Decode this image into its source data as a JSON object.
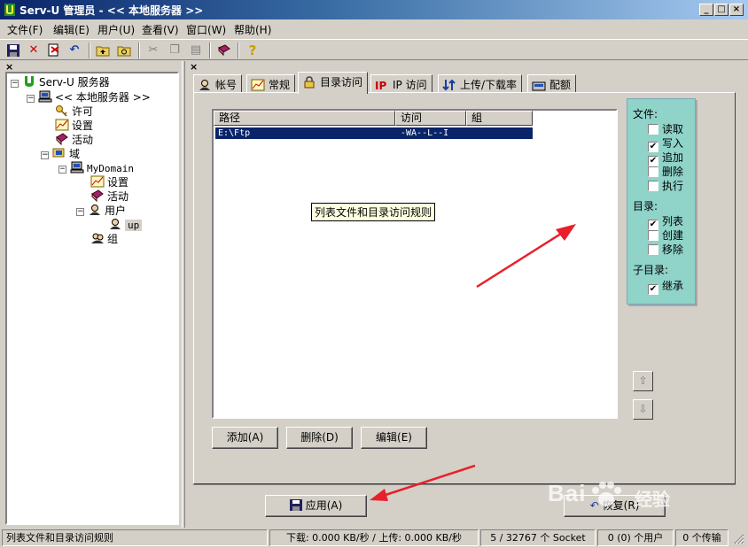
{
  "window": {
    "title": "Serv-U 管理员 - << 本地服务器 >>",
    "min_glyph": "_",
    "max_glyph": "□",
    "close_glyph": "×"
  },
  "menu": [
    "文件(F)",
    "编辑(E)",
    "用户(U)",
    "查看(V)",
    "窗口(W)",
    "帮助(H)"
  ],
  "toolbar": {
    "icons": [
      "save-icon",
      "delete-icon",
      "cut-user-icon",
      "undo-icon",
      "folder-up-icon",
      "folder-refresh-icon",
      "cut-icon",
      "copy-icon",
      "paste-icon",
      "book-icon",
      "help-icon"
    ]
  },
  "tree": {
    "close_glyph": "×",
    "expand_glyph": "−",
    "nodes": [
      {
        "label": "Serv-U 服务器"
      },
      {
        "label": "<< 本地服务器 >>"
      },
      {
        "label": "许可"
      },
      {
        "label": "设置"
      },
      {
        "label": "活动"
      },
      {
        "label": "域"
      },
      {
        "label": "MyDomain"
      },
      {
        "label": "设置"
      },
      {
        "label": "活动"
      },
      {
        "label": "用户"
      },
      {
        "label": "up"
      },
      {
        "label": "组"
      }
    ]
  },
  "tabs": [
    {
      "label": "帐号"
    },
    {
      "label": "常规"
    },
    {
      "label": "目录访问"
    },
    {
      "label": "IP 访问"
    },
    {
      "label": "上传/下载率"
    },
    {
      "label": "配额"
    }
  ],
  "directory_list": {
    "columns": [
      "路径",
      "访问",
      "組"
    ],
    "rows": [
      {
        "path": "E:\\Ftp",
        "access": "-WA--L--I",
        "group": ""
      }
    ],
    "tooltip": "列表文件和目录访问规则"
  },
  "permissions": {
    "files_label": "文件:",
    "files": [
      {
        "label": "读取",
        "checked": false
      },
      {
        "label": "写入",
        "checked": true
      },
      {
        "label": "追加",
        "checked": true
      },
      {
        "label": "删除",
        "checked": false
      },
      {
        "label": "执行",
        "checked": false
      }
    ],
    "dirs_label": "目录:",
    "dirs": [
      {
        "label": "列表",
        "checked": true
      },
      {
        "label": "创建",
        "checked": false
      },
      {
        "label": "移除",
        "checked": false
      }
    ],
    "subdirs_label": "子目录:",
    "subdirs": [
      {
        "label": "继承",
        "checked": true
      }
    ],
    "check_glyph": "✔"
  },
  "move_buttons": {
    "up_glyph": "⇧",
    "down_glyph": "⇩"
  },
  "buttons": {
    "add": "添加(A)",
    "delete": "删除(D)",
    "edit": "编辑(E)",
    "apply": "应用(A)",
    "reset": "恢复(R)"
  },
  "status": {
    "message": "列表文件和目录访问规则",
    "rates": "下载: 0.000 KB/秒 / 上传: 0.000 KB/秒",
    "sockets": "5 / 32767 个 Socket",
    "users": "0 (0) 个用户",
    "transfers": "0 个传输"
  },
  "watermark": {
    "text": "Bai",
    "sub": "经验"
  },
  "colors": {
    "selection": "#0a246a",
    "perm_panel": "#8fd3c9",
    "arrow": "#e8202a"
  }
}
